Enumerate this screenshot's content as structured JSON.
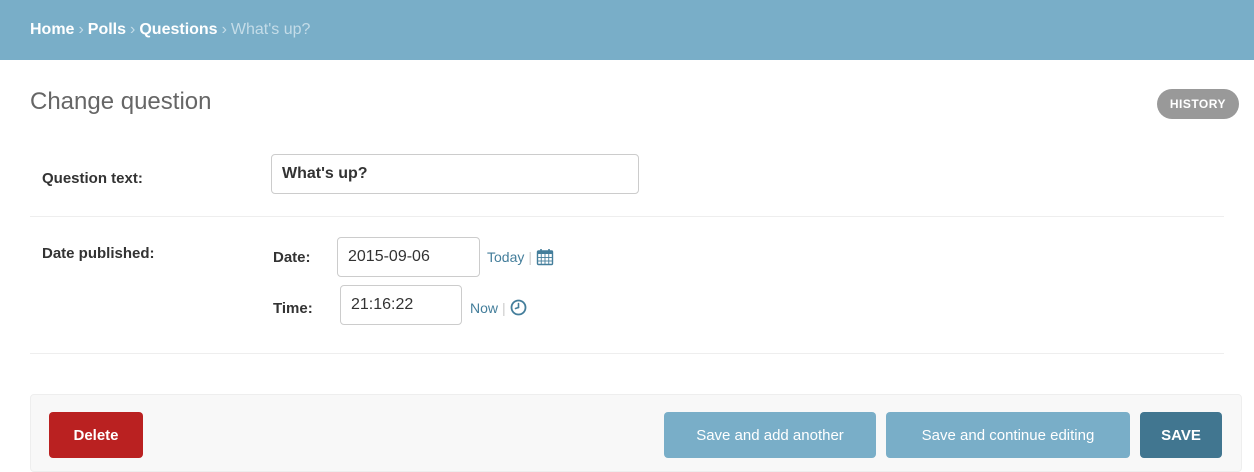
{
  "breadcrumbs": {
    "items": [
      "Home",
      "Polls",
      "Questions"
    ],
    "current": "What's up?",
    "separator": "›"
  },
  "page": {
    "title": "Change question",
    "history_label": "HISTORY"
  },
  "form": {
    "question_text": {
      "label": "Question text:",
      "value": "What's up?"
    },
    "date_published": {
      "label": "Date published:",
      "date_label": "Date:",
      "date_value": "2015-09-06",
      "today_label": "Today",
      "time_label": "Time:",
      "time_value": "21:16:22",
      "now_label": "Now",
      "pipe": "|"
    }
  },
  "actions": {
    "delete_label": "Delete",
    "save_add_label": "Save and add another",
    "save_continue_label": "Save and continue editing",
    "save_label": "SAVE"
  },
  "icons": {
    "calendar": "calendar-icon",
    "clock": "clock-icon"
  },
  "colors": {
    "header": "#79aec8",
    "link": "#447e9b",
    "delete": "#ba2121",
    "save": "#417690",
    "secondary_button": "#79aec8",
    "history": "#999999"
  }
}
